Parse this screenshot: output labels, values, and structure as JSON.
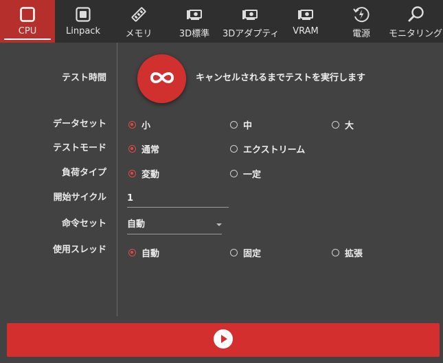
{
  "tabs": [
    {
      "label": "CPU",
      "icon": "cpu-icon",
      "active": true
    },
    {
      "label": "Linpack",
      "icon": "chip-icon",
      "active": false
    },
    {
      "label": "メモリ",
      "icon": "memory-icon",
      "active": false
    },
    {
      "label": "3D標準",
      "icon": "gpu-icon",
      "active": false
    },
    {
      "label": "3Dアダプティブ",
      "icon": "gpu-icon",
      "active": false
    },
    {
      "label": "VRAM",
      "icon": "gpu-icon",
      "active": false
    },
    {
      "label": "電源",
      "icon": "power-icon",
      "active": false
    },
    {
      "label": "モニタリング",
      "icon": "magnifier-icon",
      "active": false
    }
  ],
  "test_time": {
    "label": "テスト時間",
    "icon": "infinity-icon",
    "description": "キャンセルされるまでテストを実行します"
  },
  "dataset": {
    "label": "データセット",
    "options": [
      "小",
      "中",
      "大"
    ],
    "selected": "小"
  },
  "test_mode": {
    "label": "テストモード",
    "options": [
      "通常",
      "エクストリーム"
    ],
    "selected": "通常"
  },
  "load_type": {
    "label": "負荷タイプ",
    "options": [
      "変動",
      "一定"
    ],
    "selected": "変動"
  },
  "start_cycle": {
    "label": "開始サイクル",
    "value": "1"
  },
  "instruction_set": {
    "label": "命令セット",
    "value": "自動"
  },
  "threads": {
    "label": "使用スレッド",
    "options": [
      "自動",
      "固定",
      "拡張"
    ],
    "selected": "自動"
  },
  "start_button": {
    "icon": "play-icon"
  },
  "colors": {
    "accent": "#d32f2f",
    "active_tab": "#b5302d",
    "background": "#424242",
    "tabbar": "#2f2f2f"
  }
}
